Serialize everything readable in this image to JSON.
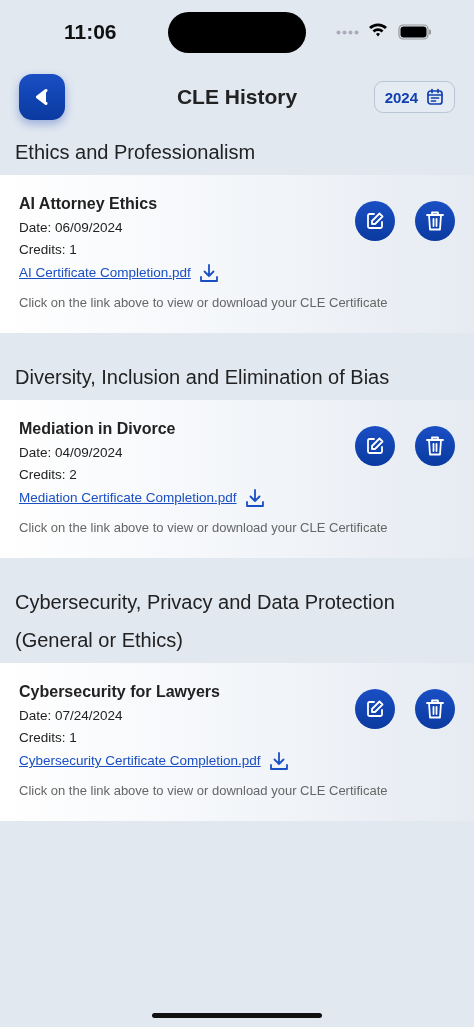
{
  "status_bar": {
    "time": "11:06"
  },
  "header": {
    "title": "CLE History",
    "year": "2024"
  },
  "sections": [
    {
      "title": "Ethics and Professionalism",
      "courses": [
        {
          "title": "AI Attorney Ethics",
          "date": "Date: 06/09/2024",
          "credits": "Credits: 1",
          "file": "AI Certificate Completion.pdf",
          "note": "Click on the link above to view or download your CLE Certificate"
        }
      ]
    },
    {
      "title": "Diversity, Inclusion and Elimination of Bias",
      "courses": [
        {
          "title": "Mediation in Divorce",
          "date": "Date: 04/09/2024",
          "credits": "Credits: 2",
          "file": "Mediation Certificate Completion.pdf",
          "note": "Click on the link above to view or download your CLE Certificate"
        }
      ]
    },
    {
      "title": "Cybersecurity, Privacy and Data Protection (General or Ethics)",
      "courses": [
        {
          "title": "Cybersecurity for Lawyers",
          "date": "Date: 07/24/2024",
          "credits": "Credits: 1",
          "file": "Cybersecurity Certificate Completion.pdf",
          "note": "Click on the link above to view or download your CLE Certificate"
        }
      ]
    }
  ]
}
